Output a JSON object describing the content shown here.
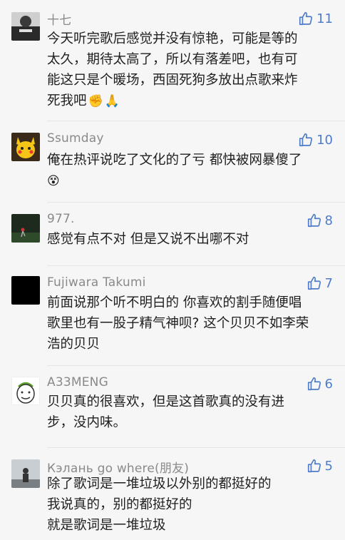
{
  "comments": [
    {
      "username": "十七",
      "likes": "11",
      "lines": [
        "今天听完歌后感觉并没有惊艳，可能是等的",
        "太久，期待太高了，所以有落差吧，也有可",
        "能这只是个暖场，西固死狗多放出点歌来炸",
        "死我吧"
      ],
      "emojis": [
        "✊",
        "🙏"
      ]
    },
    {
      "username": "Ssumday",
      "likes": "10",
      "lines": [
        "俺在热评说吃了文化的了亏 都快被网暴傻了"
      ],
      "emojis": [
        "😵"
      ]
    },
    {
      "username": "977.",
      "likes": "8",
      "lines": [
        "感觉有点不对  但是又说不出哪不对"
      ]
    },
    {
      "username": "Fujiwara Takumi",
      "likes": "7",
      "lines": [
        "前面说那个听不明白的 你喜欢的割手随便唱",
        "歌里也有一股子精气神呗? 这个贝贝不如李荣",
        "浩的贝贝"
      ]
    },
    {
      "username": "A33MENG",
      "likes": "6",
      "lines": [
        "贝贝真的很喜欢，但是这首歌真的没有进",
        "步，没内味。"
      ]
    },
    {
      "username": "Кэлань go where(朋友)",
      "likes": "5",
      "lines": [
        "除了歌词是一堆垃圾以外别的都挺好的",
        "我说真的，别的都挺好的",
        "就是歌词是一堆垃圾"
      ]
    }
  ],
  "colors": {
    "accent": "#4f7cc9",
    "username": "#8a8a8a",
    "background": "#f6f6f6"
  }
}
